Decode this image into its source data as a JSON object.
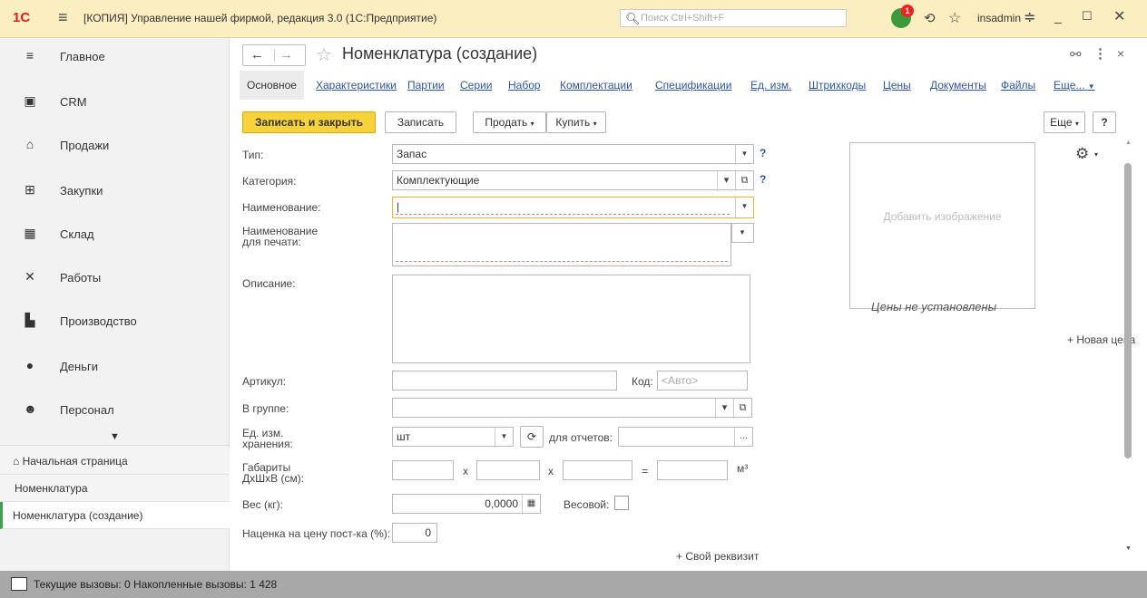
{
  "titlebar": {
    "logo": "1С",
    "app_title": "[КОПИЯ] Управление нашей фирмой, редакция 3.0  (1С:Предприятие)",
    "search_placeholder": "Поиск Ctrl+Shift+F",
    "notification_count": "1",
    "user": "insadmin"
  },
  "sidebar": {
    "items": [
      {
        "label": "Главное",
        "icon": "menu-lines-icon"
      },
      {
        "label": "CRM",
        "icon": "crm-icon"
      },
      {
        "label": "Продажи",
        "icon": "basket-icon"
      },
      {
        "label": "Закупки",
        "icon": "cart-icon"
      },
      {
        "label": "Склад",
        "icon": "warehouse-icon"
      },
      {
        "label": "Работы",
        "icon": "tools-icon"
      },
      {
        "label": "Производство",
        "icon": "factory-icon"
      },
      {
        "label": "Деньги",
        "icon": "money-icon"
      },
      {
        "label": "Персонал",
        "icon": "people-icon"
      }
    ],
    "open_windows": [
      {
        "label": "Начальная страница"
      },
      {
        "label": "Номенклатура"
      },
      {
        "label": "Номенклатура (создание)"
      }
    ]
  },
  "form": {
    "title": "Номенклатура (создание)",
    "tabs": [
      "Основное",
      "Характеристики",
      "Партии",
      "Серии",
      "Набор",
      "Комплектации",
      "Спецификации",
      "Ед. изм.",
      "Штрихкоды",
      "Цены",
      "Документы",
      "Файлы",
      "Еще..."
    ],
    "toolbar": {
      "save_close": "Записать и закрыть",
      "save": "Записать",
      "sell": "Продать",
      "buy": "Купить",
      "more": "Еще",
      "help": "?"
    },
    "fields": {
      "type_label": "Тип:",
      "type_value": "Запас",
      "category_label": "Категория:",
      "category_value": "Комплектующие",
      "name_label": "Наименование:",
      "name_value": "",
      "print_name_label_1": "Наименование",
      "print_name_label_2": "для печати:",
      "description_label": "Описание:",
      "sku_label": "Артикул:",
      "code_label": "Код:",
      "code_placeholder": "<Авто>",
      "group_label": "В группе:",
      "unit_label_1": "Ед. изм.",
      "unit_label_2": "хранения:",
      "unit_value": "шт",
      "report_label": "для отчетов:",
      "dims_label_1": "Габариты",
      "dims_label_2": "ДхШхВ (см):",
      "dims_x1": "x",
      "dims_x2": "x",
      "dims_eq": "=",
      "dims_unit": "м³",
      "weight_label": "Вес (кг):",
      "weight_value": "0,0000",
      "weighted_label": "Весовой:",
      "markup_label": "Наценка на цену пост-ка (%):",
      "markup_value": "0",
      "own_attr": "+ Свой реквизит"
    },
    "image": {
      "placeholder": "Добавить изображение"
    },
    "prices": {
      "none": "Цены не установлены",
      "new_price": "+ Новая цена"
    }
  },
  "statusbar": {
    "text": "Текущие вызовы: 0   Накопленные вызовы: 1 428"
  }
}
